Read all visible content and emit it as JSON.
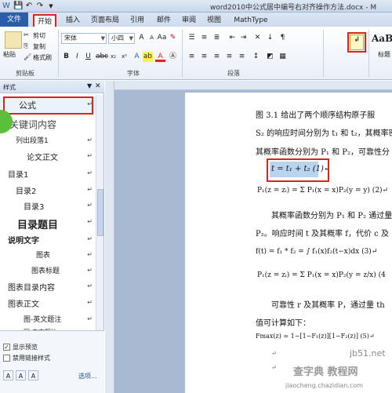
{
  "window": {
    "title": "word2010中公式居中编号右对齐操作方法.docx - M"
  },
  "ribbon_tabs": [
    "文件",
    "开始",
    "插入",
    "页面布局",
    "引用",
    "邮件",
    "审阅",
    "视图",
    "MathType"
  ],
  "clipboard": {
    "paste": "粘贴",
    "cut": "剪切",
    "copy": "复制",
    "format_painter": "格式刷",
    "group_label": "剪贴板"
  },
  "font": {
    "family": "宋体",
    "size": "小四",
    "group_label": "字体"
  },
  "paragraph": {
    "group_label": "段落"
  },
  "styles_gallery": {
    "sample": "AaBb",
    "label": "标题"
  },
  "styles_pane": {
    "title": "样式",
    "items": [
      {
        "label": "公式",
        "mark": "↵"
      },
      {
        "label": "关键词内容",
        "mark": ""
      },
      {
        "label": "列出段落1",
        "mark": "↵"
      },
      {
        "label": "论文正文",
        "mark": "↵"
      },
      {
        "label": "目录1",
        "mark": "↵"
      },
      {
        "label": "目录2",
        "mark": "↵"
      },
      {
        "label": "目录3",
        "mark": "↵"
      },
      {
        "label": "目录题目",
        "mark": "↵"
      },
      {
        "label": "说明文字",
        "mark": "↵"
      },
      {
        "label": "图表",
        "mark": "↵"
      },
      {
        "label": "图表标题",
        "mark": "↵"
      },
      {
        "label": "图表目录内容",
        "mark": "↵"
      },
      {
        "label": "图表正文",
        "mark": "↵"
      },
      {
        "label": "图-英文题注",
        "mark": "↵"
      },
      {
        "label": "图-中文题注",
        "mark": "↵"
      }
    ],
    "show_preview": "显示预览",
    "disable_linked": "禁用链接样式",
    "options": "选项..."
  },
  "document": {
    "line1": "图 3.1 给出了两个顺序结构原子服",
    "line2": "S₂ 的响应时间分别为 t₁ 和 t₂，其概率密",
    "line3": "其概率函数分别为 P₁ 和 P₂，可靠性分",
    "formula1": "t = t₁ + t₂ (1)↵",
    "formula2": "P₁(z = zᵢ) = Σ P₁(x = x)P₂(y = y) (2)↵",
    "line4": "其概率函数分别为 P₁ 和 P₂ 通过量",
    "line5": "P₂。响应时间 t 及其概率 f，代价 c 及",
    "formula3": "f(t) = f₁ * f₂ = ∫ f₁(x)f₂(t−x)dx (3)↵",
    "formula4": "P₁(z = zᵢ) = Σ P₁(x = x)P₂(y = z/x) (4",
    "line6": "可靠性 r 及其概率 P，通过量 th",
    "line7": "值可计算如下：",
    "formula5": "Fmax(z) = 1−[1−F₁(z)][1−F₂(z)] (5)↵",
    "watermark1": "jb51.net",
    "watermark2": "jiaocheng.chazidian.com",
    "watermark3": "查字典 教程网"
  },
  "colors": {
    "highlight_red": "#d9261c",
    "file_tab": "#2a5ea8",
    "formula_bg": "#b8d4ee"
  }
}
